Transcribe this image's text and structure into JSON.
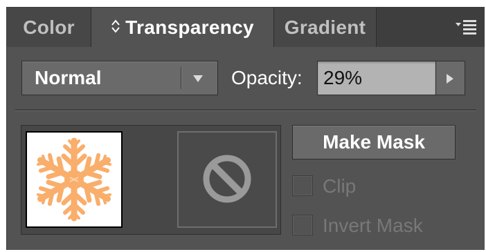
{
  "tabs": [
    {
      "label": "Color",
      "active": false
    },
    {
      "label": "Transparency",
      "active": true,
      "icon": "up-down-arrows-icon"
    },
    {
      "label": "Gradient",
      "active": false
    }
  ],
  "panel_menu_icon": "panel-menu-icon",
  "blend_mode": {
    "value": "Normal",
    "icon": "dropdown-arrow-icon"
  },
  "opacity": {
    "label": "Opacity:",
    "value": "29%",
    "icon": "play-arrow-icon"
  },
  "thumbnails": {
    "artwork_icon": "snowflake-icon",
    "mask_icon": "no-mask-icon"
  },
  "make_mask_label": "Make Mask",
  "checkboxes": {
    "clip": {
      "label": "Clip",
      "checked": false,
      "enabled": false
    },
    "invert_mask": {
      "label": "Invert Mask",
      "checked": false,
      "enabled": false
    }
  },
  "colors": {
    "panel_bg": "#535353",
    "tab_bar_bg": "#3e3e3e",
    "field_bg": "#b3b3b3",
    "snowflake": "#f9ae6b"
  }
}
